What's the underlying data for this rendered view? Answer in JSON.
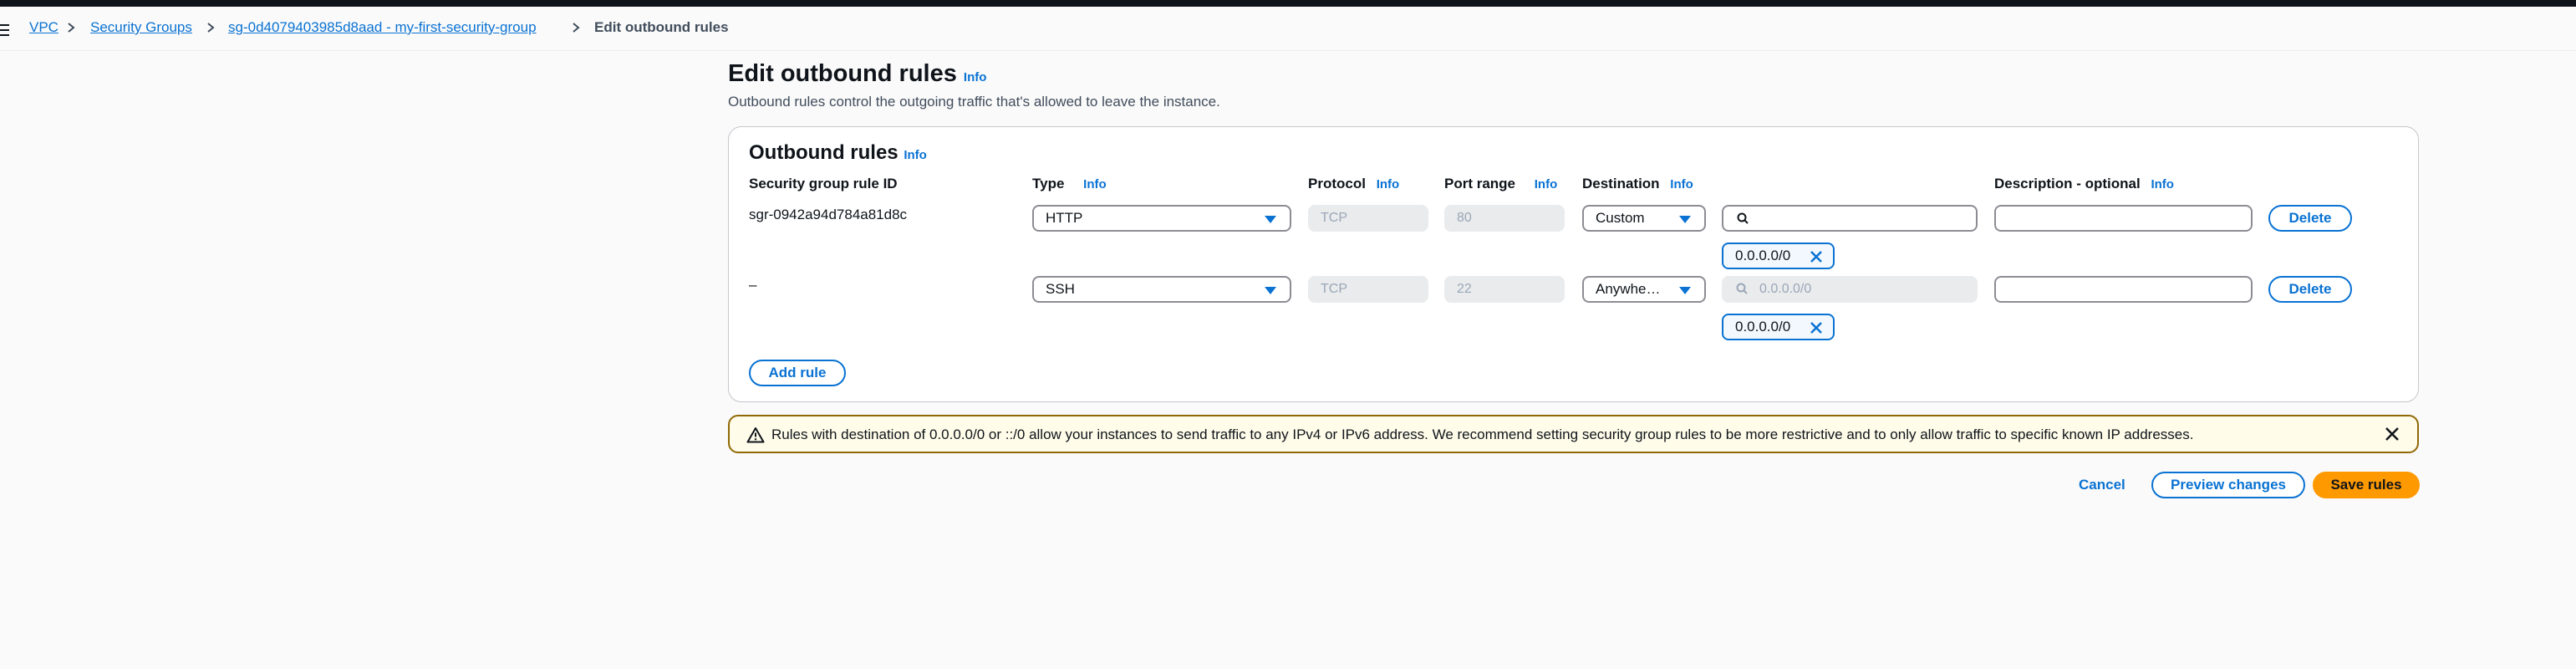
{
  "breadcrumbs": {
    "vpc": "VPC",
    "security_groups": "Security Groups",
    "group": "sg-0d4079403985d8aad - my-first-security-group",
    "current": "Edit outbound rules"
  },
  "header": {
    "title": "Edit outbound rules",
    "info": "Info",
    "description": "Outbound rules control the outgoing traffic that's allowed to leave the instance."
  },
  "panel": {
    "title": "Outbound rules",
    "info": "Info",
    "columns": {
      "rule_id": "Security group rule ID",
      "type": "Type",
      "protocol": "Protocol",
      "port_range": "Port range",
      "destination": "Destination",
      "description": "Description - optional",
      "info": "Info"
    },
    "rules": [
      {
        "rule_id": "sgr-0942a94d784a81d8c",
        "type": "HTTP",
        "protocol": "TCP",
        "port_range": "80",
        "destination": "Custom",
        "search_value": "",
        "search_placeholder": "",
        "token": "0.0.0.0/0",
        "description": "",
        "delete_label": "Delete"
      },
      {
        "rule_id": "–",
        "type": "SSH",
        "protocol": "TCP",
        "port_range": "22",
        "destination": "Anywhe…",
        "search_value": "",
        "search_placeholder": "0.0.0.0/0",
        "token": "0.0.0.0/0",
        "description": "",
        "delete_label": "Delete"
      }
    ],
    "add_rule_label": "Add rule"
  },
  "warning": {
    "text": "Rules with destination of 0.0.0.0/0 or ::/0 allow your instances to send traffic to any IPv4 or IPv6 address. We recommend setting security group rules to be more restrictive and to only allow traffic to specific known IP addresses."
  },
  "footer": {
    "cancel_label": "Cancel",
    "preview_label": "Preview changes",
    "save_label": "Save rules"
  },
  "colors": {
    "link": "#0972d3",
    "primary_button": "#ff9900",
    "warning_bg": "#fffce9",
    "warning_border": "#906806"
  },
  "icons": [
    "menu-icon",
    "chevron-right-icon",
    "caret-down-icon",
    "search-icon",
    "close-icon",
    "warning-icon"
  ]
}
